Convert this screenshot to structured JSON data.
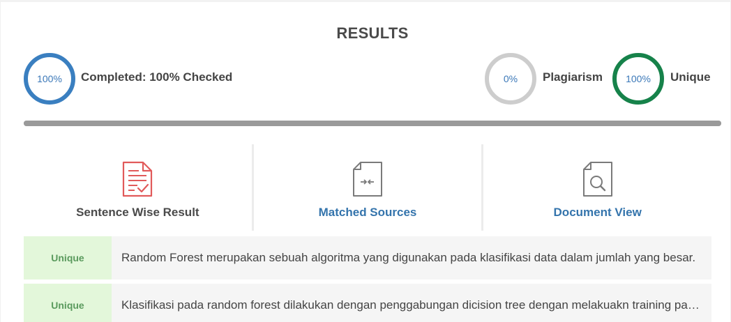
{
  "results": {
    "title": "RESULTS",
    "completed": {
      "percent_text": "100%",
      "label": "Completed: 100% Checked",
      "progress": 1.0
    },
    "plagiarism": {
      "percent_text": "0%",
      "label": "Plagiarism"
    },
    "unique": {
      "percent_text": "100%",
      "label": "Unique"
    }
  },
  "tabs": [
    {
      "label": "Sentence Wise Result",
      "icon": "checklist-document-icon",
      "active": true
    },
    {
      "label": "Matched Sources",
      "icon": "compare-document-icon",
      "active": false
    },
    {
      "label": "Document View",
      "icon": "magnify-document-icon",
      "active": false
    }
  ],
  "sentences": [
    {
      "status": "Unique",
      "text": "Random Forest merupakan sebuah algoritma yang digunakan pada klasifikasi data dalam jumlah yang besar."
    },
    {
      "status": "Unique",
      "text": "Klasifikasi pada random forest dilakukan dengan penggabungan dicision tree dengan melakuakn training pada sampel data."
    }
  ],
  "colors": {
    "completed_ring": "#3a7fc0",
    "plagiarism_ring": "#cdcdcd",
    "unique_ring": "#16824a",
    "active_icon": "#e15a5a",
    "link": "#3474ac",
    "unique_badge_bg": "#e3f7da"
  }
}
